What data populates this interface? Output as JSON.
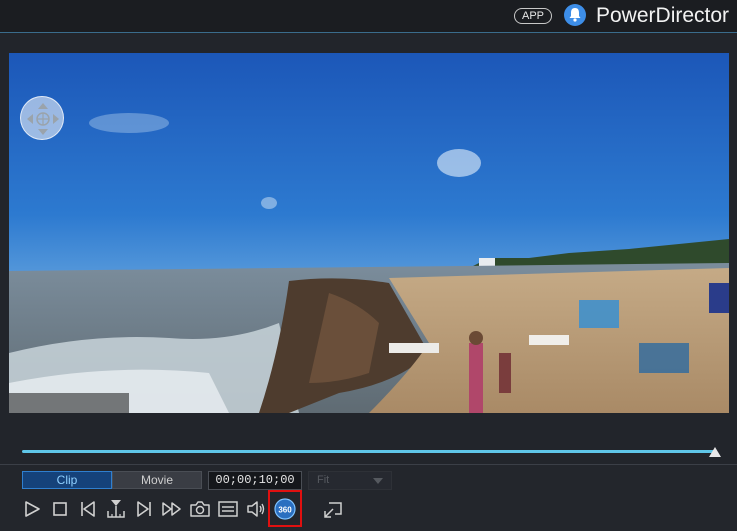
{
  "titlebar": {
    "app_badge": "APP",
    "title": "PowerDirector"
  },
  "icons": [
    "bell-icon",
    "navigation-pad-icon",
    "play-icon",
    "stop-icon",
    "previous-frame-icon",
    "split-icon",
    "next-frame-icon",
    "fast-forward-icon",
    "snapshot-camera-icon",
    "subtitle-icon",
    "volume-icon",
    "view-360-icon",
    "undock-window-icon",
    "dropdown-caret-icon"
  ],
  "colors": {
    "accent": "#5fc6e8",
    "highlight": "#e01010",
    "active_tab": "#15427a"
  },
  "preview": {
    "scene": "360-degree beach video frame"
  },
  "mode_toggle": {
    "clip": "Clip",
    "movie": "Movie",
    "selected": "Clip"
  },
  "timecode": "00;00;10;00",
  "fit_select": {
    "value": "Fit",
    "enabled": false
  },
  "scrubber": {
    "position_fraction": 1.0
  },
  "view_360": {
    "label": "360"
  }
}
